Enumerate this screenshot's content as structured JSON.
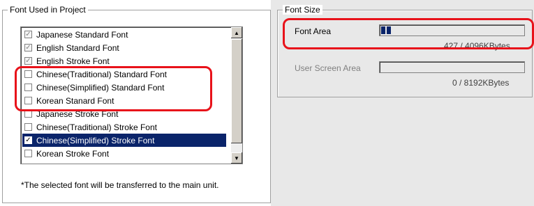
{
  "font_group": {
    "title": "Font Used in Project",
    "items": [
      {
        "label": "Japanese Standard Font",
        "state": "checked-disabled"
      },
      {
        "label": "English Standard Font",
        "state": "checked-disabled"
      },
      {
        "label": "English Stroke Font",
        "state": "checked-disabled"
      },
      {
        "label": "Chinese(Traditional) Standard Font",
        "state": "unchecked"
      },
      {
        "label": "Chinese(Simplified) Standard Font",
        "state": "unchecked"
      },
      {
        "label": "Korean Stanard Font",
        "state": "unchecked"
      },
      {
        "label": "Japanese Stroke Font",
        "state": "unchecked"
      },
      {
        "label": "Chinese(Traditional) Stroke Font",
        "state": "unchecked"
      },
      {
        "label": "Chinese(Simplified) Stroke Font",
        "state": "checked-selected"
      },
      {
        "label": "Korean Stroke Font",
        "state": "unchecked"
      }
    ],
    "note": "*The selected font will be transferred to the main unit."
  },
  "size_group": {
    "title": "Font Size",
    "font_area_label": "Font Area",
    "font_area_value": "427 / 4096KBytes",
    "font_area_fill": 0.104,
    "user_screen_label": "User Screen Area",
    "user_screen_value": "0 / 8192KBytes",
    "user_screen_fill": 0
  },
  "icons": {
    "check": "✓",
    "scroll_up": "▲",
    "scroll_down": "▼"
  },
  "colors": {
    "selection": "#0a246a",
    "annotation": "#e8121a"
  }
}
